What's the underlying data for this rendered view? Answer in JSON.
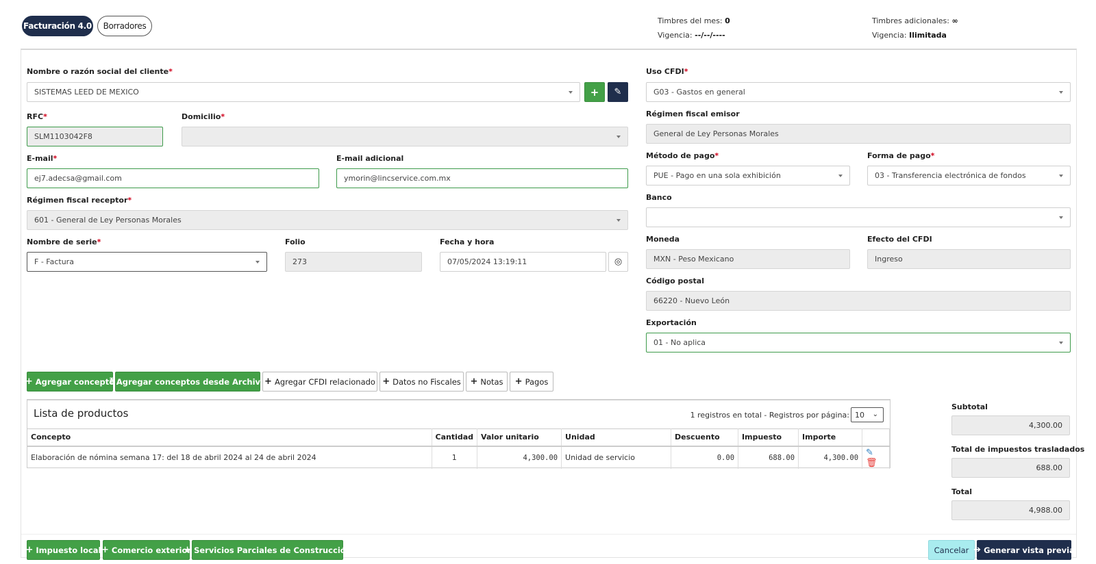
{
  "tabs": {
    "active": "Facturación 4.0",
    "drafts": "Borradores"
  },
  "stamps": {
    "month_label": "Timbres del mes:",
    "month_value": "0",
    "validity_label": "Vigencia:",
    "validity_value": "--/--/----",
    "additional_label": "Timbres adicionales:",
    "additional_value": "∞",
    "add_validity_label": "Vigencia:",
    "add_validity_value": "Ilimitada"
  },
  "form": {
    "client_label": "Nombre o razón social del cliente",
    "client_value": "SISTEMAS LEED DE MEXICO",
    "rfc_label": "RFC",
    "rfc_value": "SLM1103042F8",
    "address_label": "Domicilio",
    "address_value": "",
    "email_label": "E-mail",
    "email_value": "ej7.adecsa@gmail.com",
    "email2_label": "E-mail adicional",
    "email2_value": "ymorin@lincservice.com.mx",
    "regime_receiver_label": "Régimen fiscal receptor",
    "regime_receiver_value": "601 - General de Ley Personas Morales",
    "series_label": "Nombre de serie",
    "series_value": "F - Factura",
    "folio_label": "Folio",
    "folio_value": "273",
    "date_label": "Fecha y hora",
    "date_value": "07/05/2024 13:19:11",
    "uso_label": "Uso CFDI",
    "uso_value": "G03 - Gastos en general",
    "regime_emitter_label": "Régimen fiscal emisor",
    "regime_emitter_value": "General de Ley Personas Morales",
    "method_label": "Método de pago",
    "method_value": "PUE - Pago en una sola exhibición",
    "form_label": "Forma de pago",
    "form_value": "03 - Transferencia electrónica de fondos",
    "bank_label": "Banco",
    "bank_value": "",
    "currency_label": "Moneda",
    "currency_value": "MXN - Peso Mexicano",
    "effect_label": "Efecto del CFDI",
    "effect_value": "Ingreso",
    "zip_label": "Código postal",
    "zip_value": "66220 - Nuevo León",
    "export_label": "Exportación",
    "export_value": "01 - No aplica",
    "required_mark": "*"
  },
  "actions": {
    "add_concept": "Agregar concepto",
    "add_from_file": "Agregar conceptos desde Archivo",
    "add_related": "Agregar CFDI relacionado",
    "non_fiscal": "Datos no Fiscales",
    "notes": "Notas",
    "payments": "Pagos",
    "local_tax": "Impuesto local",
    "foreign_trade": "Comercio exterior",
    "partial_services": "Servicios Parciales de Construcción",
    "cancel": "Cancelar",
    "preview": "Generar vista previa"
  },
  "products": {
    "title": "Lista de productos",
    "pager_text": "1 registros en total - Registros por página:",
    "page_size": "10",
    "columns": [
      "Concepto",
      "Cantidad",
      "Valor unitario",
      "Unidad",
      "Descuento",
      "Impuesto",
      "Importe"
    ],
    "rows": [
      {
        "concept": "Elaboración de nómina semana 17: del 18 de abril 2024 al 24 de abril 2024",
        "qty": "1",
        "unit_value": "4,300.00",
        "unit": "Unidad de servicio",
        "discount": "0.00",
        "tax": "688.00",
        "amount": "4,300.00"
      }
    ]
  },
  "totals": {
    "subtotal_label": "Subtotal",
    "subtotal_value": "4,300.00",
    "taxes_label": "Total de impuestos trasladados",
    "taxes_value": "688.00",
    "total_label": "Total",
    "total_value": "4,988.00"
  },
  "icons": {
    "plus": "+",
    "edit": "✎",
    "trash": "🗑",
    "upload": "⤒",
    "arrow": "➔",
    "target": "◎",
    "chevron": "⌄"
  },
  "colors": {
    "navy": "#1f2e4c",
    "green": "#43a047",
    "cyan": "#a9ecef",
    "required": "#d0021b"
  }
}
